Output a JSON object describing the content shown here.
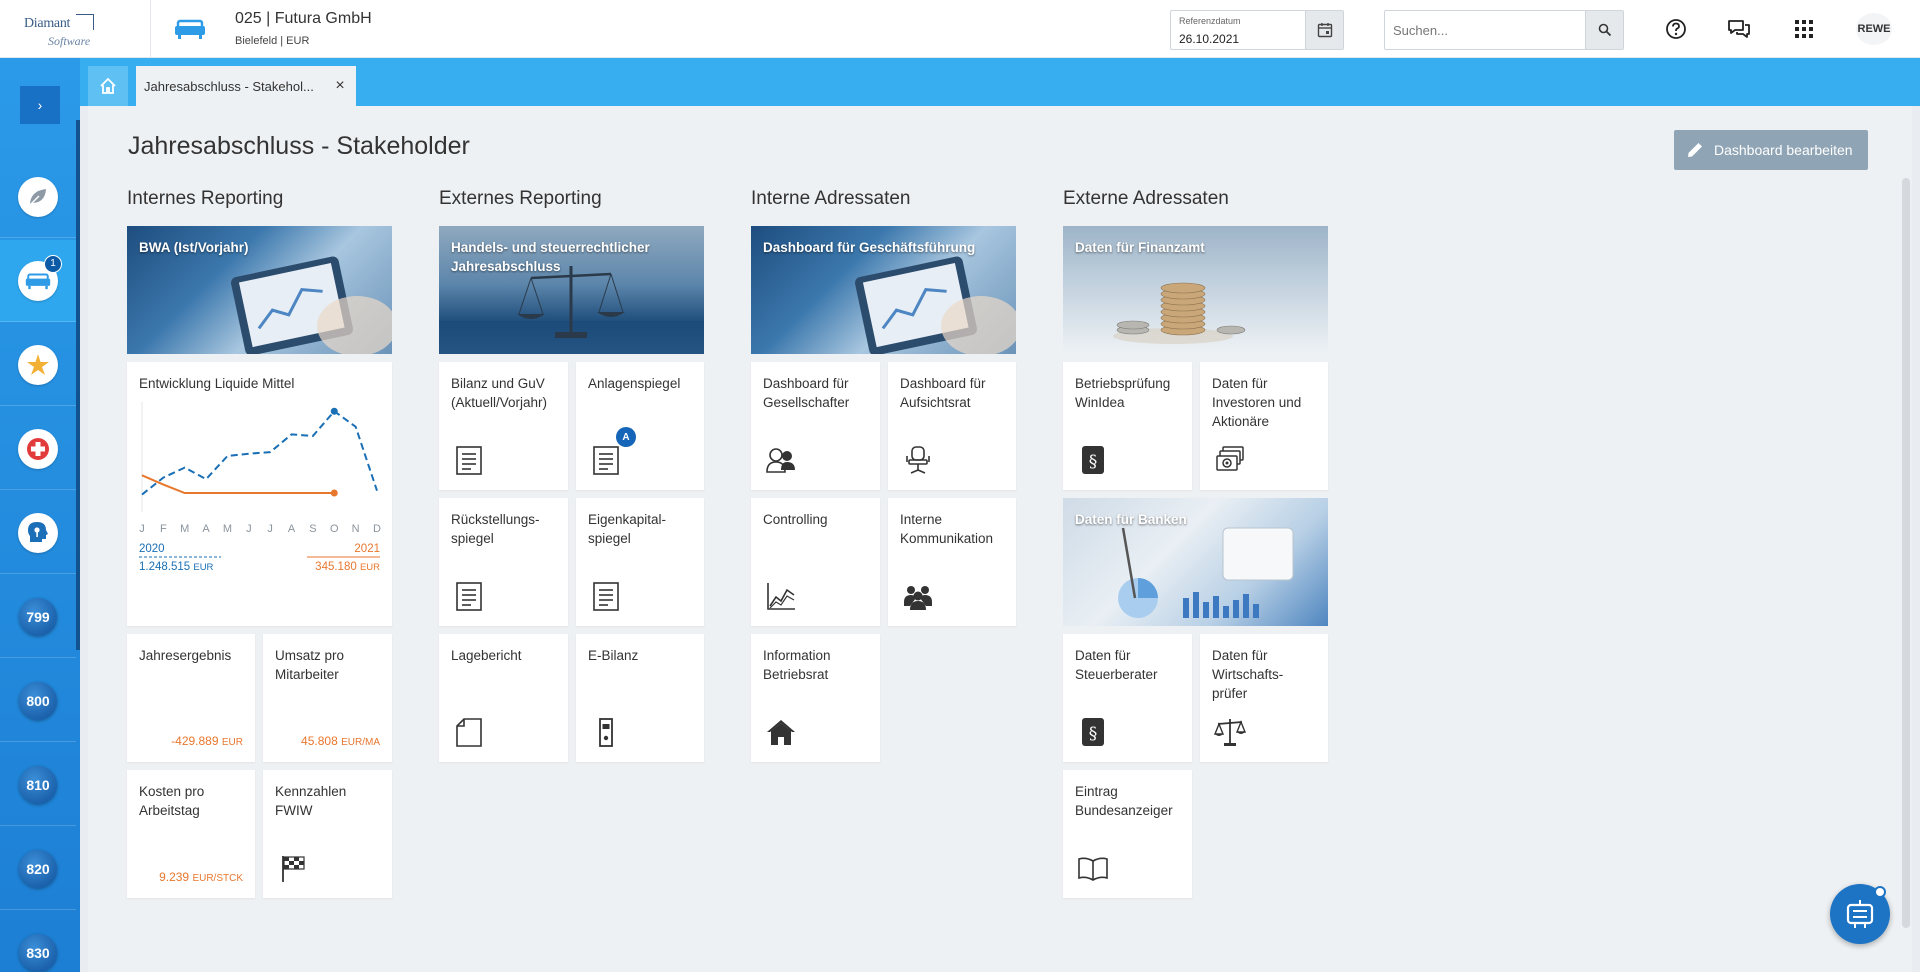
{
  "topbar": {
    "logo_top": "Diamant",
    "logo_bottom": "Software",
    "company_title": "025 | Futura GmbH",
    "company_sub": "Bielefeld | EUR",
    "refdate_label": "Referenzdatum",
    "refdate_value": "26.10.2021",
    "search_placeholder": "Suchen...",
    "user": "REWE"
  },
  "sidebar": {
    "active_badge": "1",
    "numbered": [
      "799",
      "800",
      "810",
      "820",
      "830"
    ]
  },
  "tabs": {
    "active_tab": "Jahresabschluss - Stakehol...",
    "close": "×"
  },
  "page": {
    "title": "Jahresabschluss - Stakeholder",
    "edit_button": "Dashboard bearbeiten"
  },
  "sections": {
    "internes": "Internes Reporting",
    "externes": "Externes Reporting",
    "interne_adressaten": "Interne Adressaten",
    "externe_adressaten": "Externe Adressaten"
  },
  "cards": {
    "bwa": "BWA (Ist/Vorjahr)",
    "liquide": "Entwicklung Liquide Mittel",
    "jahresergebnis": "Jahresergebnis",
    "jahresergebnis_value": "-429.889",
    "jahresergebnis_unit": "EUR",
    "umsatz": "Umsatz pro Mitarbeiter",
    "umsatz_value": "45.808",
    "umsatz_unit": "EUR/MA",
    "kosten": "Kosten pro Arbeitstag",
    "kosten_value": "9.239",
    "kosten_unit": "EUR/STCK",
    "kennzahlen": "Kennzahlen FWIW",
    "handels": "Handels- und steuerrechtlicher Jahresabschluss",
    "bilanz": "Bilanz und GuV (Aktuell/Vorjahr)",
    "anlagen": "Anlagenspiegel",
    "anlagen_badge": "A",
    "rueckstellung": "Rückstellungs-spiegel",
    "eigenkapital": "Eigenkapital-spiegel",
    "lagebericht": "Lagebericht",
    "ebilanz": "E-Bilanz",
    "dash_gf": "Dashboard für Geschäftsführung",
    "dash_ges": "Dashboard für Gesellschafter",
    "dash_auf": "Dashboard für Aufsichtsrat",
    "controlling": "Controlling",
    "interne_komm": "Interne Kommunikation",
    "info_br": "Information Betriebsrat",
    "finanzamt": "Daten für Finanzamt",
    "betriebspruefung": "Betriebsprüfung WinIdea",
    "investoren": "Daten für Investoren und Aktionäre",
    "banken": "Daten für Banken",
    "steuerberater": "Daten für Steuerberater",
    "wirtschaftspruefer": "Daten für Wirtschafts-prüfer",
    "bundesanzeiger": "Eintrag Bundesanzeiger"
  },
  "chart_data": {
    "type": "line",
    "title": "Entwicklung Liquide Mittel",
    "categories": [
      "J",
      "F",
      "M",
      "A",
      "M",
      "J",
      "J",
      "A",
      "S",
      "O",
      "N",
      "D"
    ],
    "series": [
      {
        "name": "2020",
        "values": [
          20,
          42,
          55,
          40,
          70,
          73,
          75,
          98,
          96,
          128,
          108,
          25
        ],
        "color": "#1a6fb5",
        "style": "dashed",
        "total": "1.248.515",
        "unit": "EUR"
      },
      {
        "name": "2021",
        "values": [
          45,
          33,
          22,
          22,
          22,
          22,
          22,
          22,
          22,
          22,
          null,
          null
        ],
        "color": "#e8772e",
        "style": "solid",
        "total": "345.180",
        "unit": "EUR"
      }
    ],
    "ylim": [
      0,
      140
    ],
    "xlabel": "",
    "ylabel": "",
    "grid": false,
    "legend": "bottom"
  }
}
